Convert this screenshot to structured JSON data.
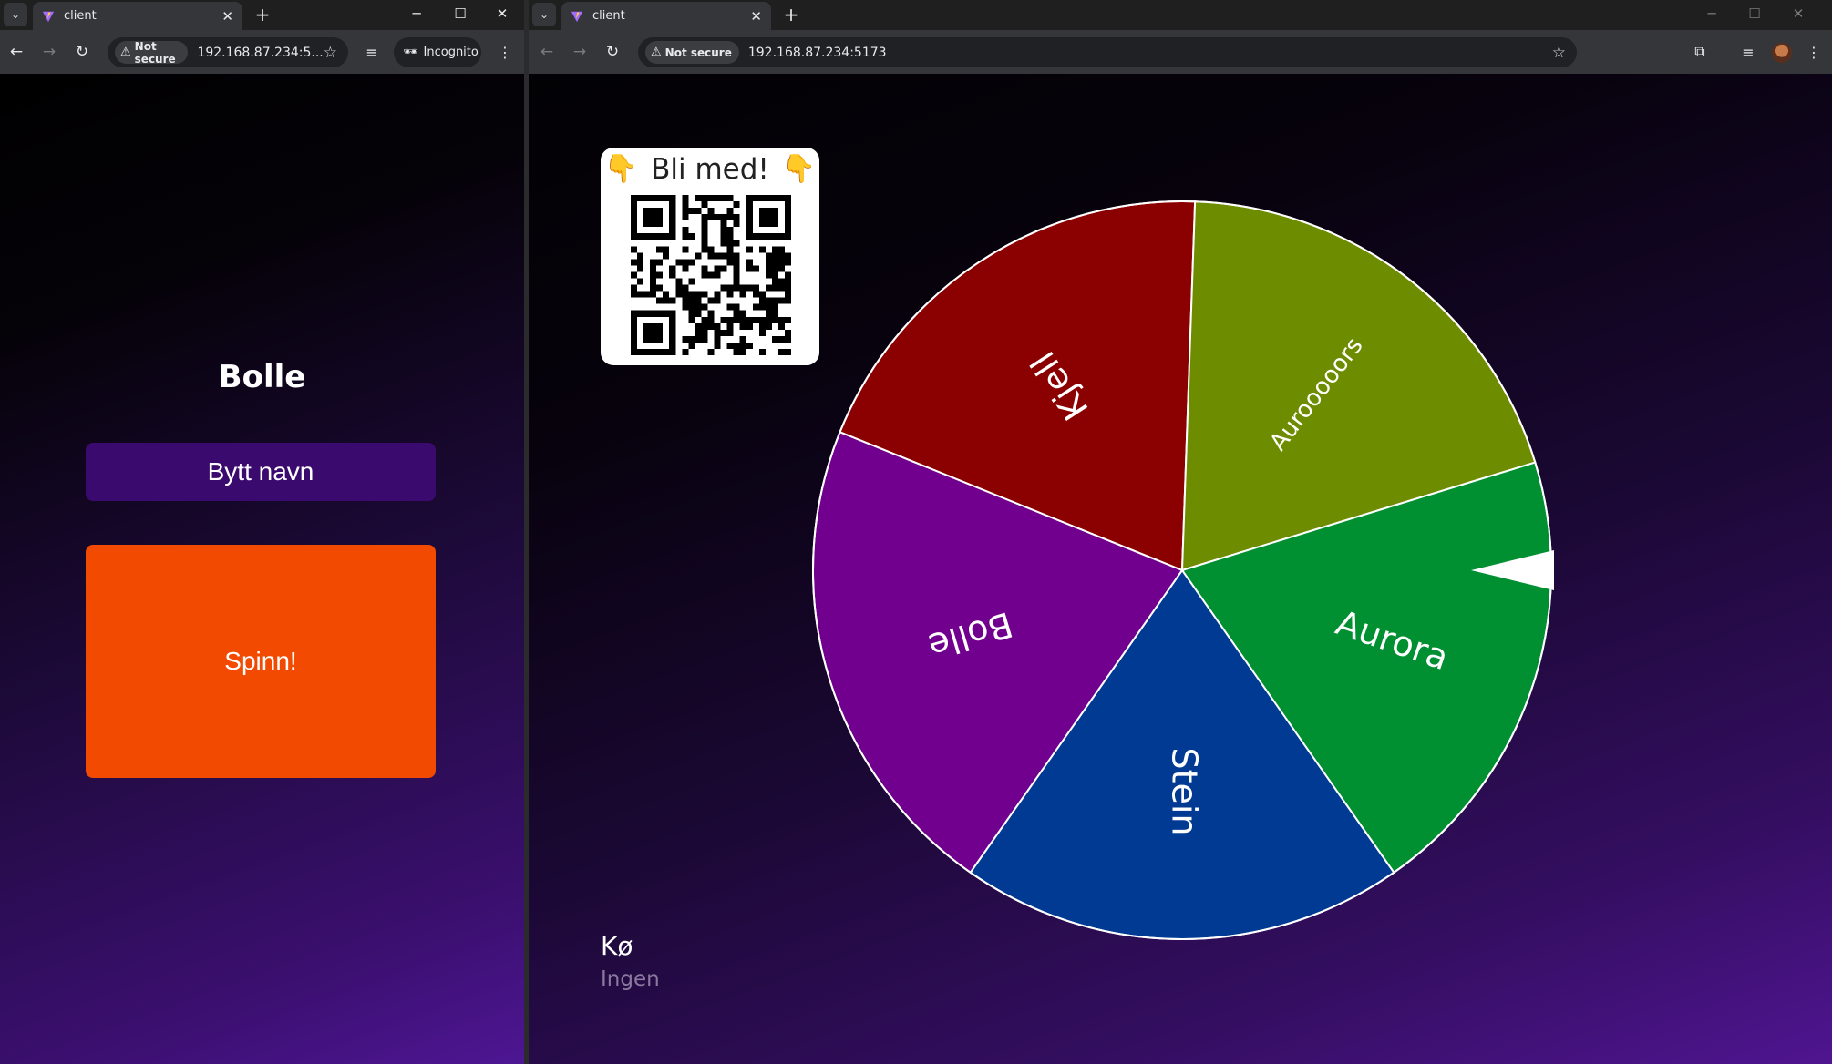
{
  "left_window": {
    "tab": {
      "title": "client"
    },
    "address": {
      "security": "Not secure",
      "url": "192.168.87.234:5..."
    },
    "incognito_label": "Incognito",
    "page": {
      "player_name": "Bolle",
      "rename_button": "Bytt navn",
      "spin_button": "Spinn!"
    }
  },
  "right_window": {
    "tab": {
      "title": "client"
    },
    "address": {
      "security": "Not secure",
      "url": "192.168.87.234:5173"
    },
    "page": {
      "join_card": {
        "title": "Bli med!"
      },
      "wheel": {
        "segments": [
          {
            "label": "Kjell",
            "color": "#8b0000"
          },
          {
            "label": "Aurooooors",
            "color": "#6e8c00"
          },
          {
            "label": "Aurora",
            "color": "#008f31"
          },
          {
            "label": "Stein",
            "color": "#003a93"
          },
          {
            "label": "Bolle",
            "color": "#72008f"
          }
        ]
      },
      "queue": {
        "title": "Kø",
        "empty_text": "Ingen"
      }
    }
  },
  "colors": {
    "rename_button": "#3b0a6e",
    "spin_button": "#f24a00",
    "background_gradient_end": "#4e1693"
  }
}
